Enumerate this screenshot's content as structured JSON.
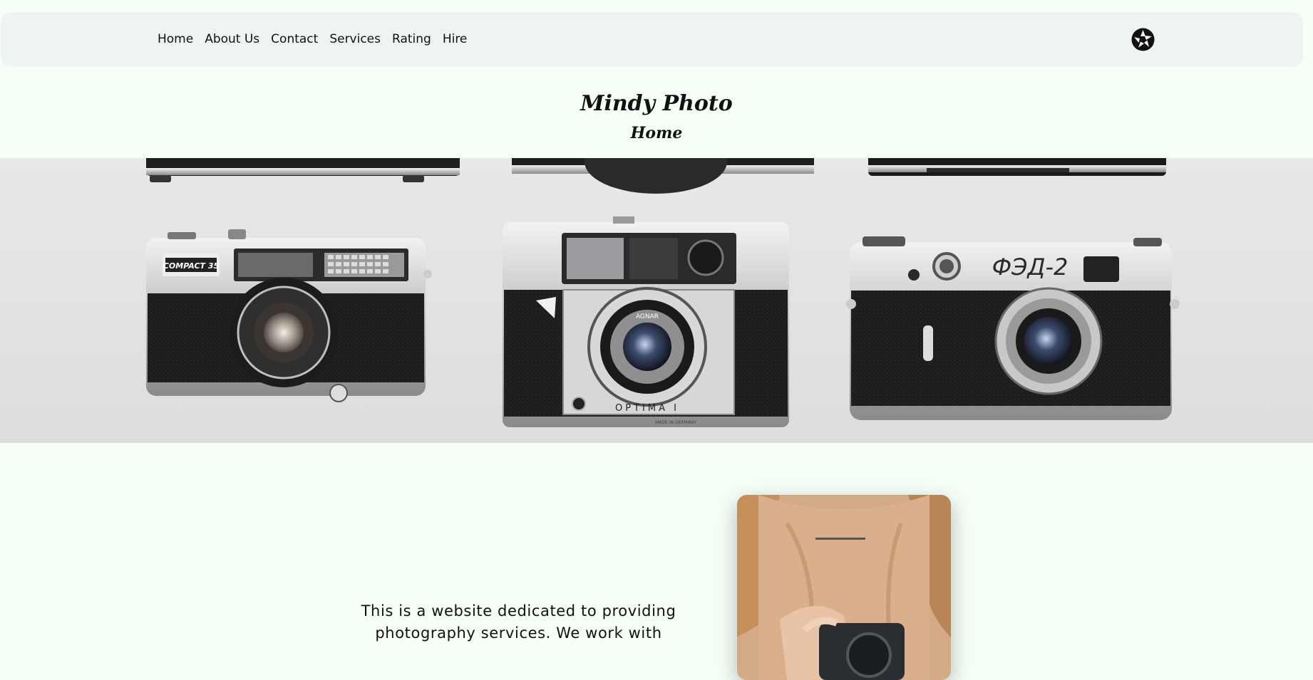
{
  "nav": {
    "links": [
      "Home",
      "About Us",
      "Contact",
      "Services",
      "Rating",
      "Hire"
    ],
    "logo_icon": "camera-aperture-icon"
  },
  "header": {
    "title": "Mindy Photo",
    "subtitle": "Home"
  },
  "hero": {
    "image": "vintage-cameras-photo",
    "camera_labels": [
      "COMPACT 35",
      "ФЭД-2",
      "OPTIMA I",
      "AGNAR",
      "MADE IN GERMANY"
    ]
  },
  "intro": {
    "text": "This is a website dedicated to providing photography services. We work with"
  },
  "photo": {
    "image": "woman-holding-camera-photo"
  },
  "colors": {
    "background": "#f5fff8",
    "navbar": "#eef4f3",
    "text": "#111111"
  }
}
